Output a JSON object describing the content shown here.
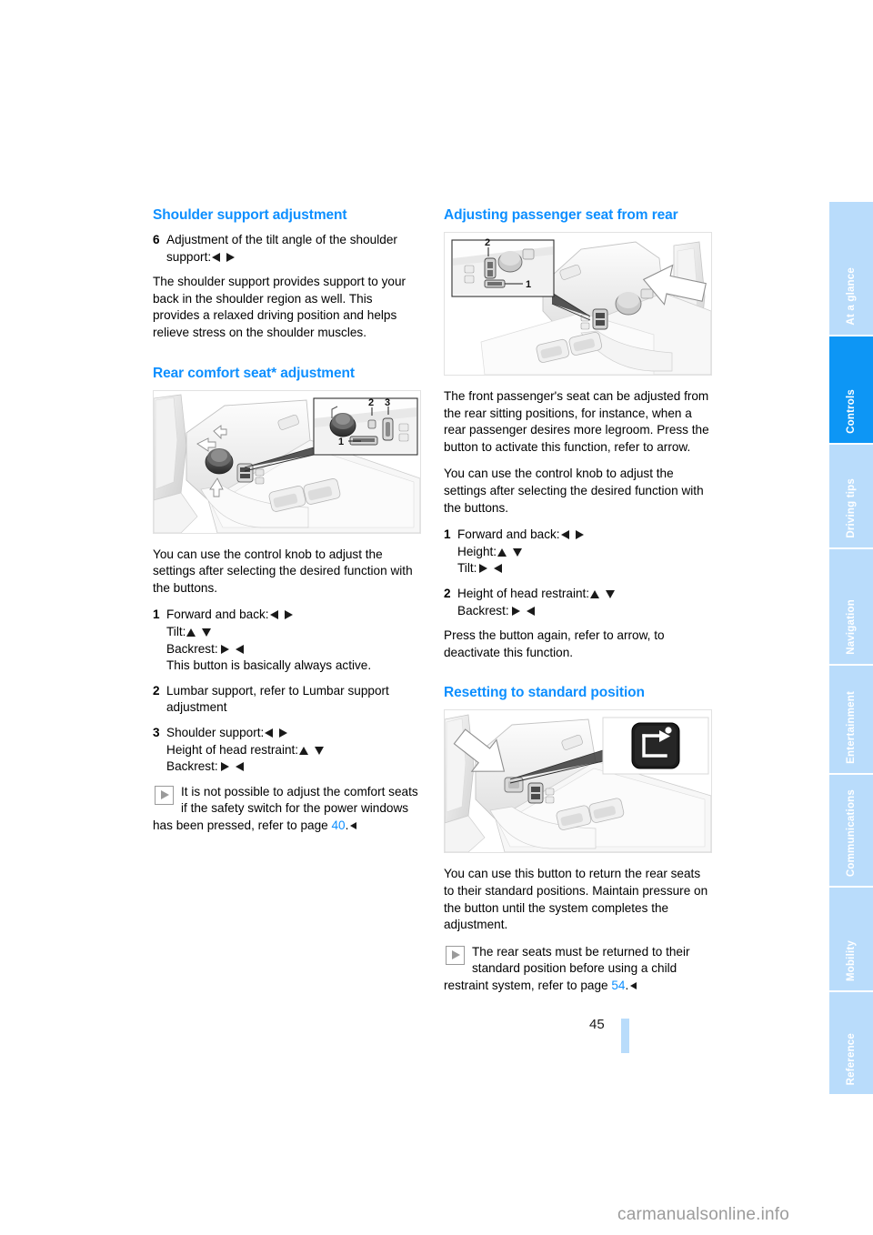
{
  "document": {
    "page_number": "45",
    "watermark": "carmanualsonline.info"
  },
  "sidebar": {
    "tabs": [
      {
        "label": "At a glance",
        "active": false
      },
      {
        "label": "Controls",
        "active": true
      },
      {
        "label": "Driving tips",
        "active": false
      },
      {
        "label": "Navigation",
        "active": false
      },
      {
        "label": "Entertainment",
        "active": false
      },
      {
        "label": "Communications",
        "active": false
      },
      {
        "label": "Mobility",
        "active": false
      },
      {
        "label": "Reference",
        "active": false
      }
    ]
  },
  "left_column": {
    "heading_1": "Shoulder support adjustment",
    "item_6_num": "6",
    "item_6_text": "Adjustment of the tilt angle of the shoulder",
    "item_6_label": "support:",
    "paragraph_1": "The shoulder support provides support to your back in the shoulder region as well. This provides a relaxed driving position and helps relieve stress on the shoulder muscles.",
    "heading_2": "Rear comfort seat* adjustment",
    "figure_1": {
      "callout_1": "1",
      "callout_2": "2",
      "callout_3": "3"
    },
    "paragraph_2": "You can use the control knob to adjust the settings after selecting the desired function with the buttons.",
    "item_1_num": "1",
    "item_1_line_1": "Forward and back:",
    "item_1_line_2": "Tilt:",
    "item_1_line_3": "Backrest:",
    "item_1_line_4": "This button is basically always active.",
    "item_2_num": "2",
    "item_2_text": "Lumbar support, refer to Lumbar support adjustment",
    "item_3_num": "3",
    "item_3_line_1": "Shoulder support:",
    "item_3_line_2": "Height of head restraint:",
    "item_3_line_3": "Backrest:",
    "note_text": "It is not possible to adjust the comfort seats if the safety switch for the power windows has been pressed, refer to page",
    "note_page_link": "40",
    "note_period": "."
  },
  "right_column": {
    "heading_1": "Adjusting passenger seat from rear",
    "figure_1": {
      "callout_1": "1",
      "callout_2": "2"
    },
    "paragraph_1": "The front passenger's seat can be adjusted from the rear sitting positions, for instance, when a rear passenger desires more legroom. Press the button to activate this function, refer to arrow.",
    "paragraph_2": "You can use the control knob to adjust the settings after selecting the desired function with the buttons.",
    "item_1_num": "1",
    "item_1_line_1": "Forward and back:",
    "item_1_line_2": "Height:",
    "item_1_line_3": "Tilt:",
    "item_2_num": "2",
    "item_2_line_1": "Height of head restraint:",
    "item_2_line_2": "Backrest:",
    "paragraph_3": "Press the button again, refer to arrow, to deactivate this function.",
    "heading_2": "Resetting to standard position",
    "paragraph_4": "You can use this button to return the rear seats to their standard positions. Maintain pressure on the button until the system completes the adjustment.",
    "note_text": "The rear seats must be returned to their standard position before using a child restraint system, refer to page",
    "note_page_link": "54",
    "note_period": "."
  },
  "colors": {
    "heading_blue": "#0d8fff",
    "tab_active_blue": "#0d96f5",
    "tab_inactive_blue": "#b9dcfb",
    "link_blue": "#0d8fff",
    "body_text": "#000000"
  }
}
